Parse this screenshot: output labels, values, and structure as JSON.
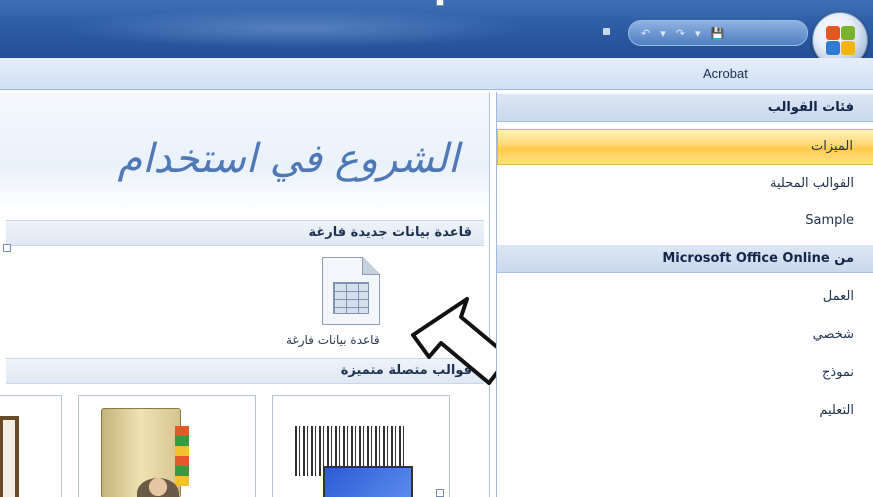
{
  "titlebar": {
    "quick_access": [
      "↶",
      "▾",
      "↷",
      "▾",
      "💾"
    ],
    "office_button": "office-button"
  },
  "ribbon": {
    "tab_acrobat": "Acrobat"
  },
  "main": {
    "title": "الشروع في استخدام",
    "section_blank": "قاعدة بيانات جديدة فارغة",
    "blank_db_label": "قاعدة بيانات فارغة",
    "section_featured": "قوالب متصلة متميزة"
  },
  "right_panel": {
    "header_categories": "فئات القوالب",
    "items_top": [
      {
        "label": "الميزات",
        "selected": true
      },
      {
        "label": "القوالب المحلية",
        "selected": false
      },
      {
        "label": "Sample",
        "selected": false
      }
    ],
    "header_online": "من Microsoft Office Online",
    "items_online": [
      {
        "label": "العمل"
      },
      {
        "label": "شخصي"
      },
      {
        "label": "نموذج"
      },
      {
        "label": "التعليم"
      }
    ]
  },
  "colors": {
    "selected_item": "#ffd76e",
    "title_blue": "#4f79b6",
    "titlebar": "#2e5ea6"
  }
}
